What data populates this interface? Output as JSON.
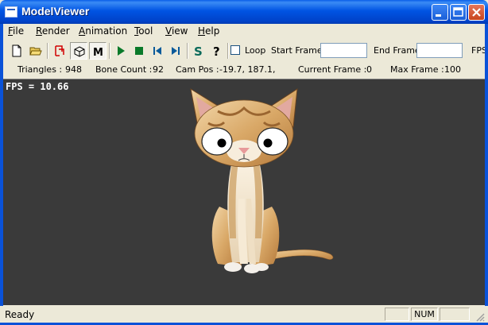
{
  "window": {
    "title": "ModelViewer"
  },
  "menubar": [
    {
      "label": "File",
      "key": "F",
      "rest": "ile"
    },
    {
      "label": "Render",
      "key": "R",
      "rest": "ender"
    },
    {
      "label": "Animation",
      "key": "A",
      "rest": "nimation"
    },
    {
      "label": "Tool",
      "key": "T",
      "rest": "ool"
    },
    {
      "label": "View",
      "key": "V",
      "rest": "iew"
    },
    {
      "label": "Help",
      "key": "H",
      "rest": "elp"
    }
  ],
  "toolbar": {
    "buttons": [
      "new-file-icon",
      "open-folder-icon",
      "select-icon",
      "mesh-icon",
      "m-icon",
      "play-icon",
      "stop-icon",
      "skip-back-icon",
      "skip-forward-icon",
      "s-icon",
      "help-icon"
    ],
    "loop_label": "Loop",
    "loop_checked": false,
    "start_frame_label": "Start Frame",
    "start_frame_value": "",
    "end_frame_label": "End Frame",
    "end_frame_value": "",
    "fps_label": "FPS"
  },
  "info": {
    "triangles_label": "Triangles :",
    "triangles_value": "948",
    "bone_count_label": "Bone Count :",
    "bone_count_value": "92",
    "cam_pos_label": "Cam Pos :",
    "cam_pos_value": "-19.7, 187.1,",
    "current_frame_label": "Current Frame :",
    "current_frame_value": "0",
    "max_frame_label": "Max Frame :",
    "max_frame_value": "100"
  },
  "viewport": {
    "fps_text": "FPS =  10.66",
    "background": "#3a3a3a"
  },
  "status": {
    "text": "Ready",
    "num_indicator": "NUM"
  },
  "colors": {
    "titlebar": "#0054e3",
    "window_bg": "#ece9d8",
    "close_button": "#c8451d"
  }
}
